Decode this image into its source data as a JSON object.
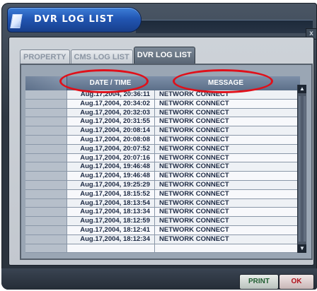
{
  "window": {
    "title": "DVR LOG LIST",
    "close_glyph": "x"
  },
  "tabs": [
    {
      "label": "PROPERTY",
      "active": false
    },
    {
      "label": "CMS LOG LIST",
      "active": false
    },
    {
      "label": "DVR LOG LIST",
      "active": true
    }
  ],
  "table": {
    "columns": [
      "DATE / TIME",
      "MESSAGE"
    ],
    "rows": [
      {
        "datetime": "Aug.17,2004, 20:36:11",
        "message": "NETWORK CONNECT"
      },
      {
        "datetime": "Aug.17,2004, 20:34:02",
        "message": "NETWORK CONNECT"
      },
      {
        "datetime": "Aug.17,2004, 20:32:03",
        "message": "NETWORK CONNECT"
      },
      {
        "datetime": "Aug.17,2004, 20:31:55",
        "message": "NETWORK CONNECT"
      },
      {
        "datetime": "Aug.17,2004, 20:08:14",
        "message": "NETWORK CONNECT"
      },
      {
        "datetime": "Aug.17,2004, 20:08:08",
        "message": "NETWORK CONNECT"
      },
      {
        "datetime": "Aug.17,2004, 20:07:52",
        "message": "NETWORK CONNECT"
      },
      {
        "datetime": "Aug.17,2004, 20:07:16",
        "message": "NETWORK CONNECT"
      },
      {
        "datetime": "Aug.17,2004, 19:46:48",
        "message": "NETWORK CONNECT"
      },
      {
        "datetime": "Aug.17,2004, 19:46:48",
        "message": "NETWORK CONNECT"
      },
      {
        "datetime": "Aug.17,2004, 19:25:29",
        "message": "NETWORK CONNECT"
      },
      {
        "datetime": "Aug.17,2004, 18:15:52",
        "message": "NETWORK CONNECT"
      },
      {
        "datetime": "Aug.17,2004, 18:13:54",
        "message": "NETWORK CONNECT"
      },
      {
        "datetime": "Aug.17,2004, 18:13:34",
        "message": "NETWORK CONNECT"
      },
      {
        "datetime": "Aug.17,2004, 18:12:59",
        "message": "NETWORK CONNECT"
      },
      {
        "datetime": "Aug.17,2004, 18:12:41",
        "message": "NETWORK CONNECT"
      },
      {
        "datetime": "Aug.17,2004, 18:12:34",
        "message": "NETWORK CONNECT"
      },
      {
        "datetime": "",
        "message": ""
      }
    ]
  },
  "buttons": {
    "print": "PRINT",
    "ok": "OK"
  },
  "colors": {
    "annotation_ring": "#e0101a",
    "title_blue": "#2256b3"
  },
  "icons": {
    "title": "document-icon",
    "close": "close-icon",
    "scroll_up": "arrow-up-icon",
    "scroll_down": "arrow-down-icon"
  }
}
